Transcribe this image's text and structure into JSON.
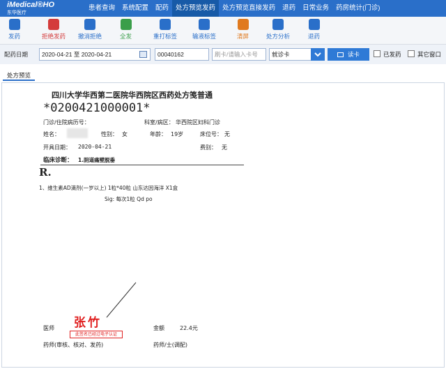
{
  "brand": {
    "name": "iMedical®HO",
    "subtitle": "东华医疗"
  },
  "nav": {
    "tabs": [
      {
        "label": "患者查询",
        "active": false
      },
      {
        "label": "系统配置",
        "active": false
      },
      {
        "label": "配药",
        "active": false
      },
      {
        "label": "处方预览发药",
        "active": true
      },
      {
        "label": "处方预览直接发药",
        "active": false
      },
      {
        "label": "退药",
        "active": false
      },
      {
        "label": "日常业务",
        "active": false
      },
      {
        "label": "药房统计(门诊)",
        "active": false
      }
    ]
  },
  "toolbar": {
    "items": [
      {
        "label": "发药",
        "icon": "dispense-icon",
        "color": "#2a6fc9"
      },
      {
        "label": "拒绝发药",
        "icon": "refuse-icon",
        "color": "#d43b3b"
      },
      {
        "label": "撤消拒绝",
        "icon": "undo-refuse-icon",
        "color": "#2a6fc9"
      },
      {
        "label": "全发",
        "icon": "dispense-all-icon",
        "color": "#3a9e4a"
      },
      {
        "label": "重打标签",
        "icon": "reprint-label-icon",
        "color": "#2a6fc9"
      },
      {
        "label": "输液标签",
        "icon": "infusion-label-icon",
        "color": "#2a6fc9"
      },
      {
        "label": "清屏",
        "icon": "clear-screen-icon",
        "color": "#e07a1f"
      },
      {
        "label": "处方分析",
        "icon": "analysis-icon",
        "color": "#2a6fc9"
      },
      {
        "label": "退药",
        "icon": "return-icon",
        "color": "#2a6fc9"
      }
    ]
  },
  "search": {
    "date_label": "配药日期",
    "date_range": "2020-04-21 至 2020-04-21",
    "reg_no": "00040162",
    "card_placeholder": "刷卡/请输入卡号",
    "card_type": "就诊卡",
    "read_card": "读卡",
    "dispensed_label": "已发药",
    "other_window_label": "其它窗口"
  },
  "panel": {
    "tab_label": "处方预览"
  },
  "prescription": {
    "hospital_title": "四川大学华西第二医院华西院区西药处方笺普通",
    "barcode_text": "*0200421000001*",
    "visit_label": "门诊/住院病历号：",
    "dept_label": "科室/病区：",
    "dept_value": "华西院区妇科门诊",
    "name_label": "姓名：",
    "sex_label": "性别：",
    "sex_value": "女",
    "age_label": "年龄：",
    "age_value": "19岁",
    "bed_label": "床位号：",
    "bed_value": "无",
    "date_label": "开具日期：",
    "date_value": "2020-04-21",
    "category_label": "费别：",
    "category_value": "无",
    "diagnosis_label": "临床诊断：",
    "diagnosis_value": "1.阴道痛壁脱垂",
    "rx_symbol": "R.",
    "drug_line": "1、维生素AD滴剂(一岁以上) 1粒*40粒 山东达因海洋 X1盒",
    "sig_line": "Sig: 每次1粒 Qd po",
    "doctor_label": "医师",
    "doctor_signature": "张竹",
    "stamp_text": "此签名已经过电子认证",
    "amount_label": "金额",
    "amount_value": "22.4元",
    "pharmacist_review_label": "药师(审核、核对、发药)",
    "pharmacist_prep_label": "药师/士(调配)"
  },
  "colors": {
    "nav_bg": "#2a6fc9",
    "nav_active": "#175aa7",
    "stamp_red": "#e02020"
  }
}
